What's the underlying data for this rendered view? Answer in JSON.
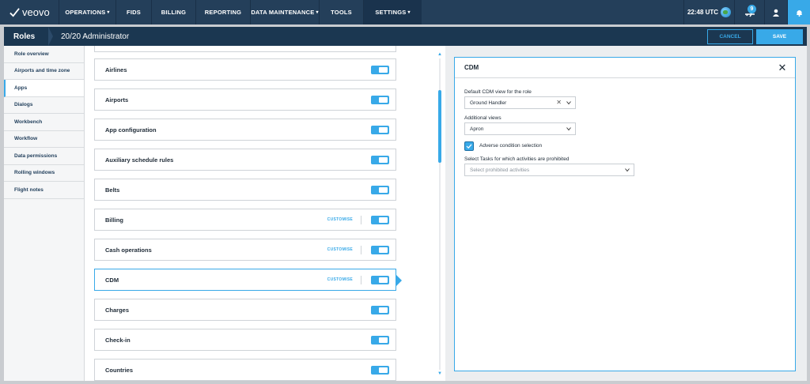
{
  "nav": {
    "brand": "veovo",
    "items": [
      {
        "label": "OPERATIONS",
        "caret": "▾"
      },
      {
        "label": "FIDS"
      },
      {
        "label": "BILLING"
      },
      {
        "label": "REPORTING"
      },
      {
        "label": "DATA MAINTENANCE",
        "caret": "▾"
      },
      {
        "label": "TOOLS"
      },
      {
        "label": "SETTINGS",
        "caret": "▾",
        "active": true
      }
    ],
    "time": "22:48 UTC",
    "notification_count": "9"
  },
  "header": {
    "section": "Roles",
    "role_name": "20/20 Administrator",
    "cancel_label": "CANCEL",
    "save_label": "SAVE"
  },
  "sidebar": {
    "items": [
      "Role overview",
      "Airports and time zone",
      "Apps",
      "Dialogs",
      "Workbench",
      "Workflow",
      "Data permissions",
      "Rolling windows",
      "Flight notes"
    ],
    "active_index": 2
  },
  "apps": {
    "customise_label": "CUSTOMISE",
    "items": [
      {
        "name": "",
        "enabled": true
      },
      {
        "name": "Airlines",
        "enabled": true
      },
      {
        "name": "Airports",
        "enabled": true
      },
      {
        "name": "App configuration",
        "enabled": true
      },
      {
        "name": "Auxiliary schedule rules",
        "enabled": true
      },
      {
        "name": "Belts",
        "enabled": true
      },
      {
        "name": "Billing",
        "enabled": true,
        "customise": true
      },
      {
        "name": "Cash operations",
        "enabled": true,
        "customise": true
      },
      {
        "name": "CDM",
        "enabled": true,
        "customise": true,
        "selected": true
      },
      {
        "name": "Charges",
        "enabled": true
      },
      {
        "name": "Check-in",
        "enabled": true
      },
      {
        "name": "Countries",
        "enabled": true
      }
    ]
  },
  "panel": {
    "title": "CDM",
    "default_view_label": "Default CDM view for the role",
    "default_view_value": "Ground Handler",
    "additional_views_label": "Additional views",
    "additional_views_value": "Apron",
    "adverse_label": "Adverse condition selection",
    "adverse_checked": true,
    "tasks_label": "Select Tasks for which activities are prohibited",
    "tasks_placeholder": "Select prohibited activities"
  },
  "colors": {
    "nav_bg": "#243f5a",
    "header_bg": "#1b3751",
    "accent": "#38a9e8"
  }
}
